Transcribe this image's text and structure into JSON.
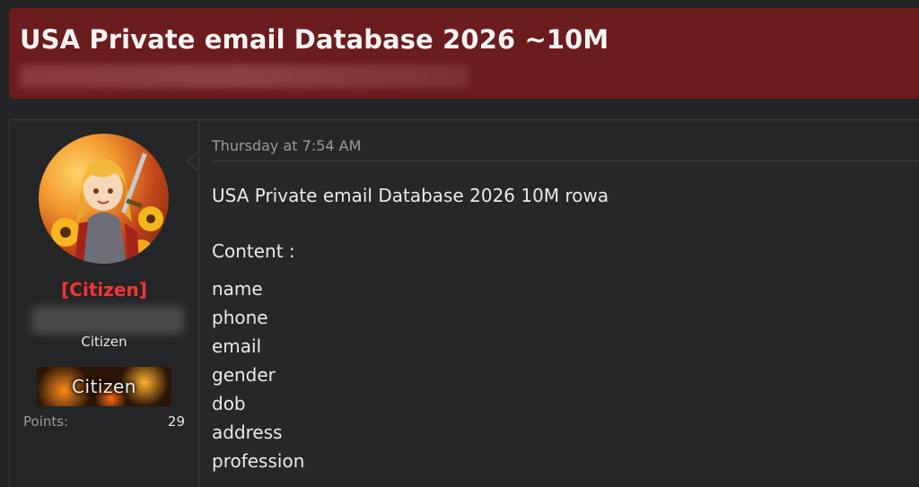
{
  "thread": {
    "title": "USA Private email Database 2026 ~10M"
  },
  "post": {
    "date": "Thursday at 7:54 AM",
    "heading": "USA Private email Database 2026 10M rowa",
    "content_label": "Content :",
    "fields": [
      "name",
      "phone",
      "email",
      "gender",
      "dob",
      "address",
      "profession"
    ]
  },
  "user": {
    "name": "[Citizen]",
    "title": "Citizen",
    "banner": "Citizen",
    "points_label": "Points:",
    "points_value": "29"
  },
  "colors": {
    "header_bg": "#6b1c1c",
    "username": "#e23b3b",
    "page_bg": "#232425"
  }
}
